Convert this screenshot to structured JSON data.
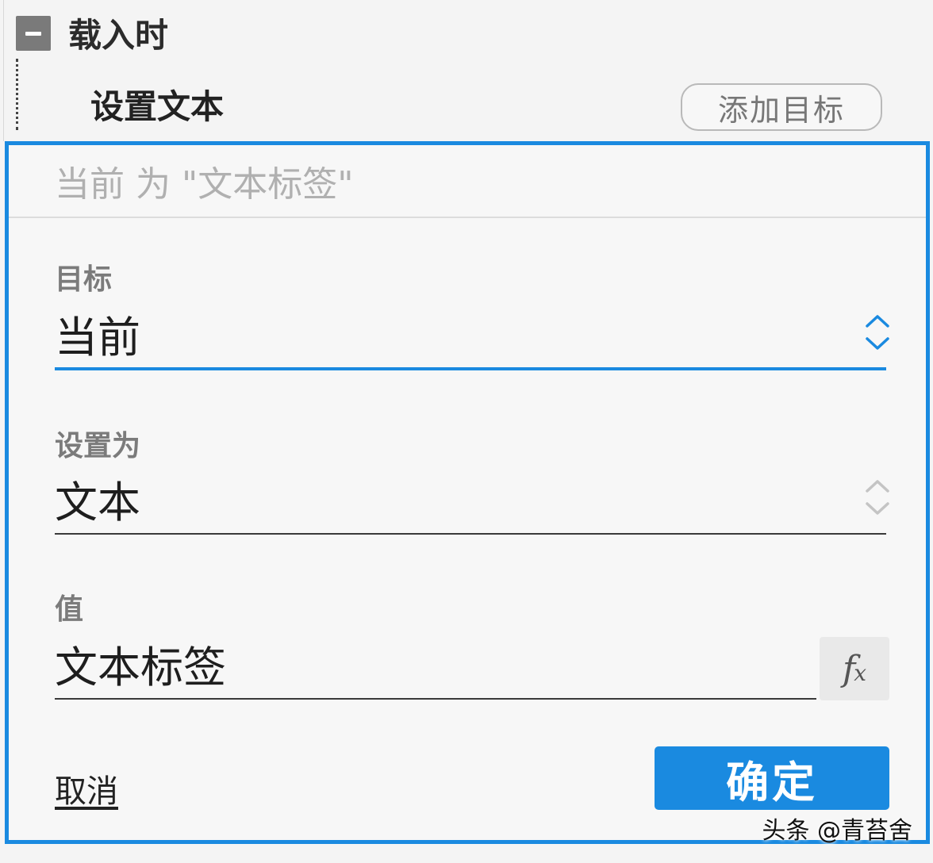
{
  "event": {
    "title": "载入时",
    "collapse_icon": "minus-square-icon"
  },
  "action": {
    "title": "设置文本",
    "add_target_label": "添加目标"
  },
  "panel": {
    "summary": "当前 为 \"文本标签\"",
    "target": {
      "label": "目标",
      "value": "当前"
    },
    "set_as": {
      "label": "设置为",
      "value": "文本"
    },
    "value": {
      "label": "值",
      "value": "文本标签",
      "fx_icon": "fx-icon"
    },
    "cancel_label": "取消",
    "ok_label": "确定"
  },
  "colors": {
    "accent": "#1a8ae0",
    "panel_bg": "#f7f7f7",
    "label_gray": "#7b7b7b"
  },
  "watermark": "头条 @青苔舍"
}
